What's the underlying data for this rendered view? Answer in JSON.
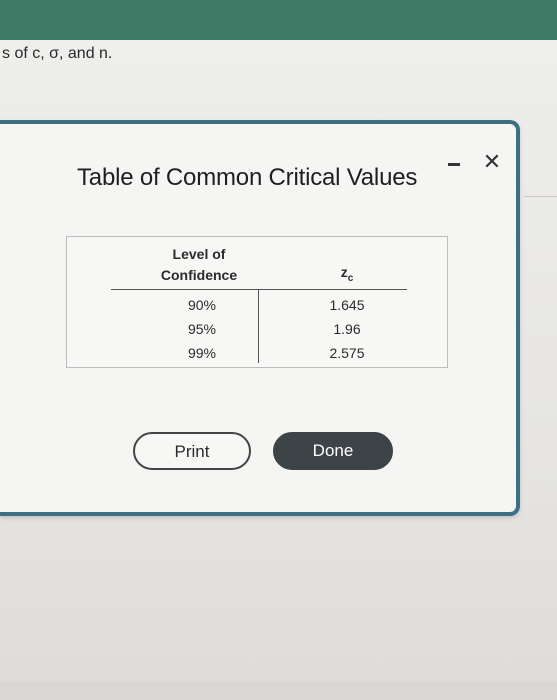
{
  "background": {
    "partial_text": "s of c, σ, and n."
  },
  "dialog": {
    "title": "Table of Common Critical Values",
    "minimize_icon": "minimize-icon",
    "close_label": "✕",
    "table": {
      "header_level": "Level of Confidence",
      "header_z": "z",
      "header_z_sub": "c",
      "rows": [
        {
          "confidence": "90%",
          "zc": "1.645"
        },
        {
          "confidence": "95%",
          "zc": "1.96"
        },
        {
          "confidence": "99%",
          "zc": "2.575"
        }
      ]
    },
    "print_label": "Print",
    "done_label": "Done"
  },
  "colors": {
    "top_bar": "#3f7a66",
    "dialog_border": "#3c6f86",
    "done_button": "#3d4448"
  }
}
